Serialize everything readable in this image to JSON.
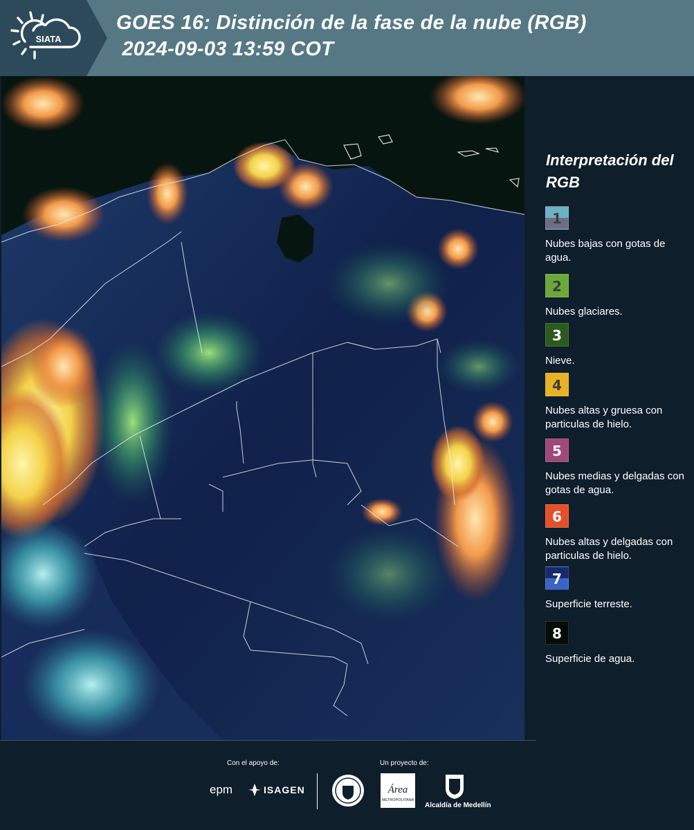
{
  "header": {
    "logo_text": "SIATA",
    "title_line1": "GOES 16: Distinción de la fase de la nube (RGB)",
    "title_line2": " 2024-09-03 13:59 COT"
  },
  "legend": {
    "title": "Interpretación del RGB",
    "items": [
      {
        "num": "1",
        "label": "Nubes bajas con gotas de agua.",
        "color_top": "#6cb2c2",
        "color_bottom": "#6f6d85",
        "num_color": "#3d3d3d"
      },
      {
        "num": "2",
        "label": "Nubes glaciares.",
        "color_top": "#6ba83a",
        "color_bottom": "#6ba83a",
        "num_color": "#3d3d3d"
      },
      {
        "num": "3",
        "label": "Nieve.",
        "color_top": "#2c5a1e",
        "color_bottom": "#2c5a1e",
        "num_color": "#ffffff"
      },
      {
        "num": "4",
        "label": "Nubes altas y gruesa con particulas de hielo.",
        "color_top": "#e7b224",
        "color_bottom": "#e7b224",
        "num_color": "#3d3d3d"
      },
      {
        "num": "5",
        "label": "Nubes medias y delgadas con gotas de agua.",
        "color_top": "#a04878",
        "color_bottom": "#a04878",
        "num_color": "#ffffff"
      },
      {
        "num": "6",
        "label": "Nubes altas y delgadas con particulas de hielo.",
        "color_top": "#e4502a",
        "color_bottom": "#e4502a",
        "num_color": "#ffffff"
      },
      {
        "num": "7",
        "label": "Superficie terreste.",
        "color_top": "#162a6b",
        "color_bottom": "#3a64c4",
        "num_color": "#ffffff"
      },
      {
        "num": "8",
        "label": "Superficie de agua.",
        "color_top": "#050c08",
        "color_bottom": "#050c08",
        "num_color": "#ffffff"
      }
    ]
  },
  "footer": {
    "support_label": "Con el apoyo de:",
    "project_label": "Un proyecto de:",
    "sponsor_epm": "epm",
    "sponsor_isagen": "ISAGEN",
    "area_text": "Área",
    "area_sub": "METROPOLITANA",
    "alcaldia": "Alcaldía de Medellín"
  },
  "colors": {
    "header_dark": "#2c4a5a",
    "header_main": "#557884",
    "background": "#0e1e2a"
  }
}
